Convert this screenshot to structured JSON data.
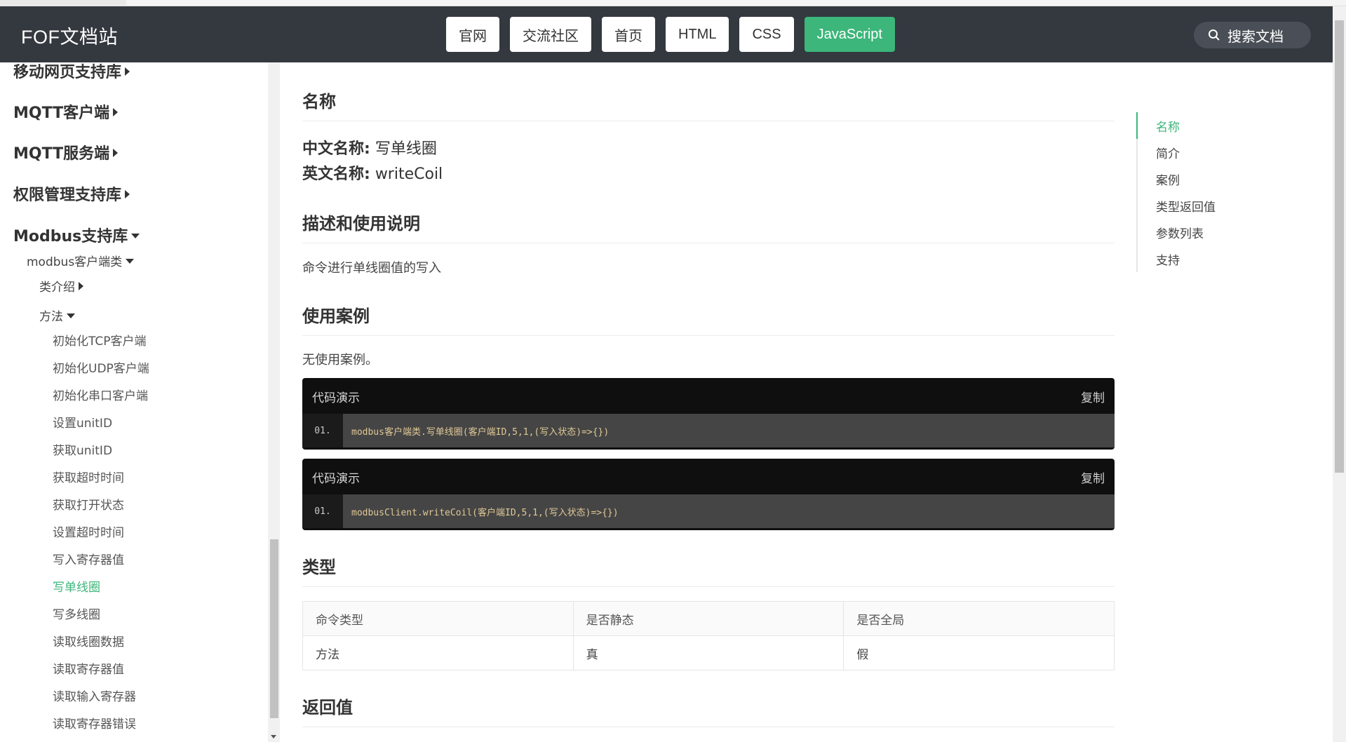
{
  "header": {
    "brand": "FOF文档站",
    "nav": [
      "官网",
      "交流社区",
      "首页",
      "HTML",
      "CSS",
      "JavaScript"
    ],
    "active_nav": "JavaScript",
    "search_label": "搜索文档"
  },
  "sidebar": {
    "top_items": [
      "移动网页支持库",
      "MQTT客户端",
      "MQTT服务端",
      "权限管理支持库",
      "Modbus支持库"
    ],
    "sub_group": "modbus客户端类",
    "class_intro": "类介绍",
    "methods_group": "方法",
    "methods": [
      "初始化TCP客户端",
      "初始化UDP客户端",
      "初始化串口客户端",
      "设置unitID",
      "获取unitID",
      "获取超时时间",
      "获取打开状态",
      "设置超时时间",
      "写入寄存器值",
      "写单线圈",
      "写多线圈",
      "读取线圈数据",
      "读取寄存器值",
      "读取输入寄存器",
      "读取寄存器错误"
    ],
    "active_method": "写单线圈"
  },
  "main": {
    "name_heading": "名称",
    "cn_label": "中文名称:",
    "cn_value": "写单线圈",
    "en_label": "英文名称:",
    "en_value": "writeCoil",
    "desc_heading": "描述和使用说明",
    "desc_text": "命令进行单线圈值的写入",
    "example_heading": "使用案例",
    "example_text": "无使用案例。",
    "code_blocks": [
      {
        "title": "代码演示",
        "copy": "复制",
        "line_no": "01.",
        "code": "modbus客户端类.写单线圈(客户端ID,5,1,(写入状态)=>{})"
      },
      {
        "title": "代码演示",
        "copy": "复制",
        "line_no": "01.",
        "code": "modbusClient.writeCoil(客户端ID,5,1,(写入状态)=>{})"
      }
    ],
    "type_heading": "类型",
    "type_table": {
      "headers": [
        "命令类型",
        "是否静态",
        "是否全局"
      ],
      "row": [
        "方法",
        "真",
        "假"
      ]
    },
    "return_heading": "返回值"
  },
  "toc": {
    "items": [
      "名称",
      "简介",
      "案例",
      "类型返回值",
      "参数列表",
      "支持"
    ],
    "active": "名称"
  },
  "colors": {
    "header_bg": "#34383f",
    "accent": "#3cb67a",
    "code_bg": "#0f0f0f"
  }
}
